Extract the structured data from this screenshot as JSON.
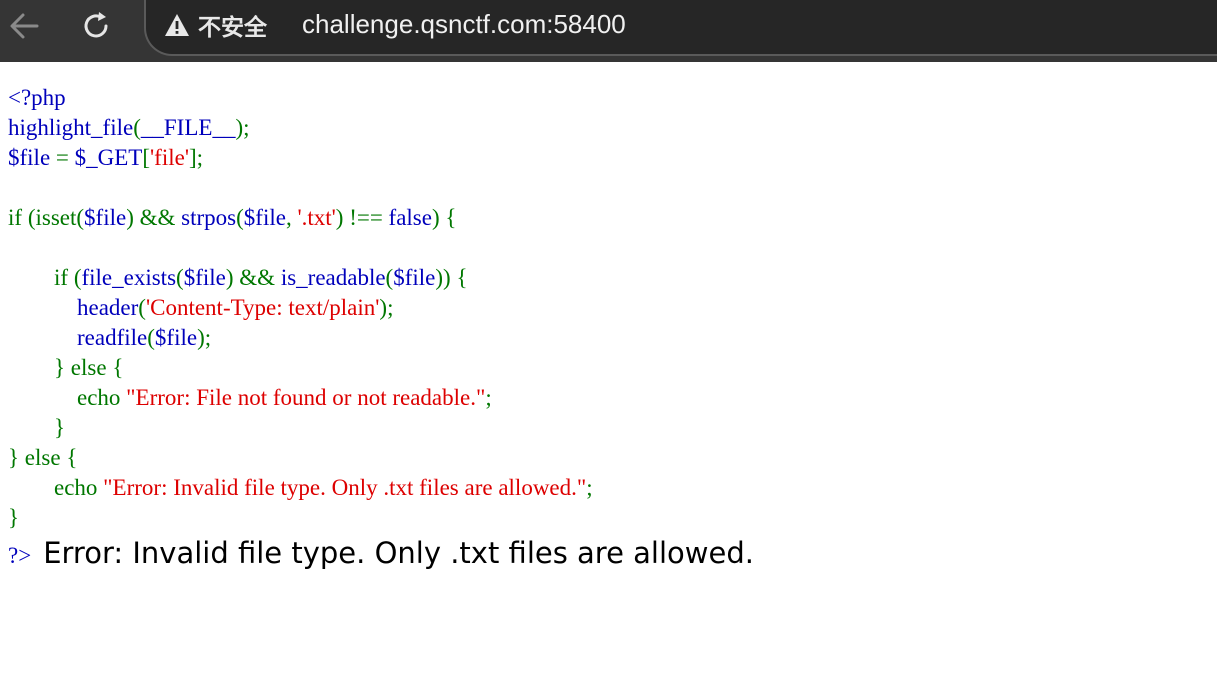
{
  "browser": {
    "security_label": "不安全",
    "url": "challenge.qsnctf.com:58400",
    "icons": {
      "back": "back-arrow-icon",
      "reload": "reload-icon",
      "warning": "warning-triangle-icon"
    }
  },
  "code": {
    "lines": [
      [
        {
          "t": "<?php",
          "c": "v"
        }
      ],
      [
        {
          "t": "highlight_file",
          "c": "v"
        },
        {
          "t": "(",
          "c": "k"
        },
        {
          "t": "__FILE__",
          "c": "v"
        },
        {
          "t": ");",
          "c": "k"
        }
      ],
      [
        {
          "t": "$file ",
          "c": "v"
        },
        {
          "t": "= ",
          "c": "k"
        },
        {
          "t": "$_GET",
          "c": "v"
        },
        {
          "t": "[",
          "c": "k"
        },
        {
          "t": "'file'",
          "c": "s"
        },
        {
          "t": "];",
          "c": "k"
        }
      ],
      [],
      [
        {
          "t": "if ",
          "c": "k"
        },
        {
          "t": "(",
          "c": "k"
        },
        {
          "t": "isset",
          "c": "k"
        },
        {
          "t": "(",
          "c": "k"
        },
        {
          "t": "$file",
          "c": "v"
        },
        {
          "t": ") ",
          "c": "k"
        },
        {
          "t": "&& ",
          "c": "k"
        },
        {
          "t": "strpos",
          "c": "v"
        },
        {
          "t": "(",
          "c": "k"
        },
        {
          "t": "$file",
          "c": "v"
        },
        {
          "t": ", ",
          "c": "k"
        },
        {
          "t": "'.txt'",
          "c": "s"
        },
        {
          "t": ") ",
          "c": "k"
        },
        {
          "t": "!== ",
          "c": "k"
        },
        {
          "t": "false",
          "c": "v"
        },
        {
          "t": ") ",
          "c": "k"
        },
        {
          "t": "{",
          "c": "k"
        }
      ],
      [],
      [
        {
          "t": "        if ",
          "c": "k"
        },
        {
          "t": "(",
          "c": "k"
        },
        {
          "t": "file_exists",
          "c": "v"
        },
        {
          "t": "(",
          "c": "k"
        },
        {
          "t": "$file",
          "c": "v"
        },
        {
          "t": ") ",
          "c": "k"
        },
        {
          "t": "&& ",
          "c": "k"
        },
        {
          "t": "is_readable",
          "c": "v"
        },
        {
          "t": "(",
          "c": "k"
        },
        {
          "t": "$file",
          "c": "v"
        },
        {
          "t": ")) ",
          "c": "k"
        },
        {
          "t": "{",
          "c": "k"
        }
      ],
      [
        {
          "t": "            header",
          "c": "v"
        },
        {
          "t": "(",
          "c": "k"
        },
        {
          "t": "'Content-Type: text/plain'",
          "c": "s"
        },
        {
          "t": ");",
          "c": "k"
        }
      ],
      [
        {
          "t": "            readfile",
          "c": "v"
        },
        {
          "t": "(",
          "c": "k"
        },
        {
          "t": "$file",
          "c": "v"
        },
        {
          "t": ");",
          "c": "k"
        }
      ],
      [
        {
          "t": "        } ",
          "c": "k"
        },
        {
          "t": "else ",
          "c": "k"
        },
        {
          "t": "{",
          "c": "k"
        }
      ],
      [
        {
          "t": "            echo ",
          "c": "k"
        },
        {
          "t": "\"Error: File not found or not readable.\"",
          "c": "s"
        },
        {
          "t": ";",
          "c": "k"
        }
      ],
      [
        {
          "t": "        }",
          "c": "k"
        }
      ],
      [
        {
          "t": "} ",
          "c": "k"
        },
        {
          "t": "else ",
          "c": "k"
        },
        {
          "t": "{",
          "c": "k"
        }
      ],
      [
        {
          "t": "        echo ",
          "c": "k"
        },
        {
          "t": "\"Error: Invalid file type. Only .txt files are allowed.\"",
          "c": "s"
        },
        {
          "t": ";",
          "c": "k"
        }
      ],
      [
        {
          "t": "}",
          "c": "k"
        }
      ]
    ],
    "closing_tag": "?>",
    "colors": {
      "default": "#0000BB",
      "keyword": "#007700",
      "string": "#DD0000"
    }
  },
  "output": {
    "text": "Error: Invalid file type. Only .txt files are allowed."
  }
}
